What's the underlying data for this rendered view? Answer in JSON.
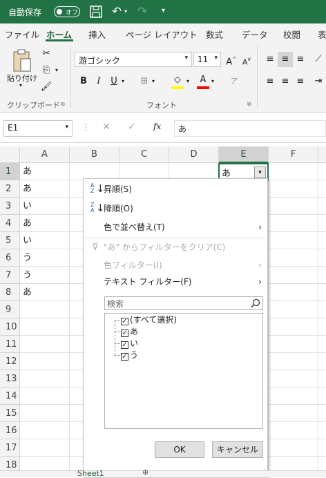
{
  "title_bar": {
    "autosave_label": "自動保存",
    "autosave_state": "オフ"
  },
  "tabs": [
    "ファイル",
    "ホーム",
    "挿入",
    "ページ レイアウト",
    "数式",
    "データ",
    "校閲",
    "表"
  ],
  "ribbon": {
    "paste_label": "貼り付け",
    "clipboard_label": "クリップボード",
    "font_name": "游ゴシック",
    "font_size": "11",
    "grow": "A",
    "shrink": "A",
    "bold": "B",
    "italic": "I",
    "underline": "U",
    "font_group_label": "フォント"
  },
  "formula_bar": {
    "name_box": "E1",
    "fx": "fx",
    "content": "あ"
  },
  "grid": {
    "columns": [
      "A",
      "B",
      "C",
      "D",
      "E",
      "F"
    ],
    "rows": [
      "1",
      "2",
      "3",
      "4",
      "5",
      "6",
      "7",
      "8",
      "9",
      "10",
      "11",
      "12",
      "13",
      "14",
      "15",
      "16",
      "17",
      "18"
    ],
    "col_a": [
      "あ",
      "あ",
      "い",
      "あ",
      "い",
      "う",
      "う",
      "あ"
    ],
    "e1": "あ"
  },
  "filter_menu": {
    "sort_asc": "昇順(S)",
    "sort_desc": "降順(O)",
    "sort_by_color": "色で並べ替え(T)",
    "clear_filter": "\"あ\" からフィルターをクリア(C)",
    "color_filter": "色フィルター(I)",
    "text_filter": "テキスト フィルター(F)",
    "search_placeholder": "検索",
    "items": [
      "(すべて選択)",
      "あ",
      "い",
      "う"
    ],
    "ok": "OK",
    "cancel": "キャンセル"
  },
  "sheet_tab": "Sheet1"
}
